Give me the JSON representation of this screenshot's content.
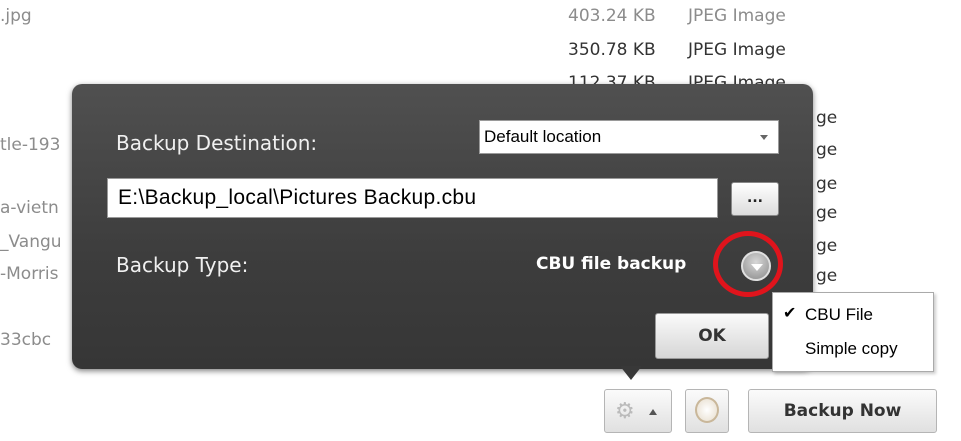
{
  "background": {
    "top_left_name": ".jpg",
    "rows": [
      {
        "size": "403.24 KB",
        "type": "JPEG Image"
      },
      {
        "size": "350.78 KB",
        "type": "JPEG Image"
      },
      {
        "size": "112.37 KB",
        "type": "JPEG Image"
      }
    ],
    "left_fragments": [
      "tle-193",
      "a-vietn",
      "_Vangu",
      "-Morris",
      "33cbc"
    ],
    "right_fragments": [
      "ge",
      "ge",
      "ge",
      "ge",
      "ge",
      "ge"
    ]
  },
  "dialog": {
    "destination_label": "Backup Destination:",
    "destination_value": "Default location",
    "path_value": "E:\\Backup_local\\Pictures Backup.cbu",
    "browse_label": "...",
    "type_label": "Backup Type:",
    "type_value": "CBU file backup",
    "ok_label": "OK"
  },
  "type_menu": {
    "items": [
      {
        "label": "CBU File",
        "checked": true
      },
      {
        "label": "Simple copy",
        "checked": false
      }
    ]
  },
  "toolbar": {
    "backup_now_label": "Backup Now"
  },
  "colors": {
    "highlight": "#e0141c",
    "dialog_bg": "#454545"
  },
  "icons": [
    "gear-icon",
    "caret-up-icon",
    "alarm-clock-icon",
    "chevron-down-icon",
    "checkmark-icon"
  ]
}
